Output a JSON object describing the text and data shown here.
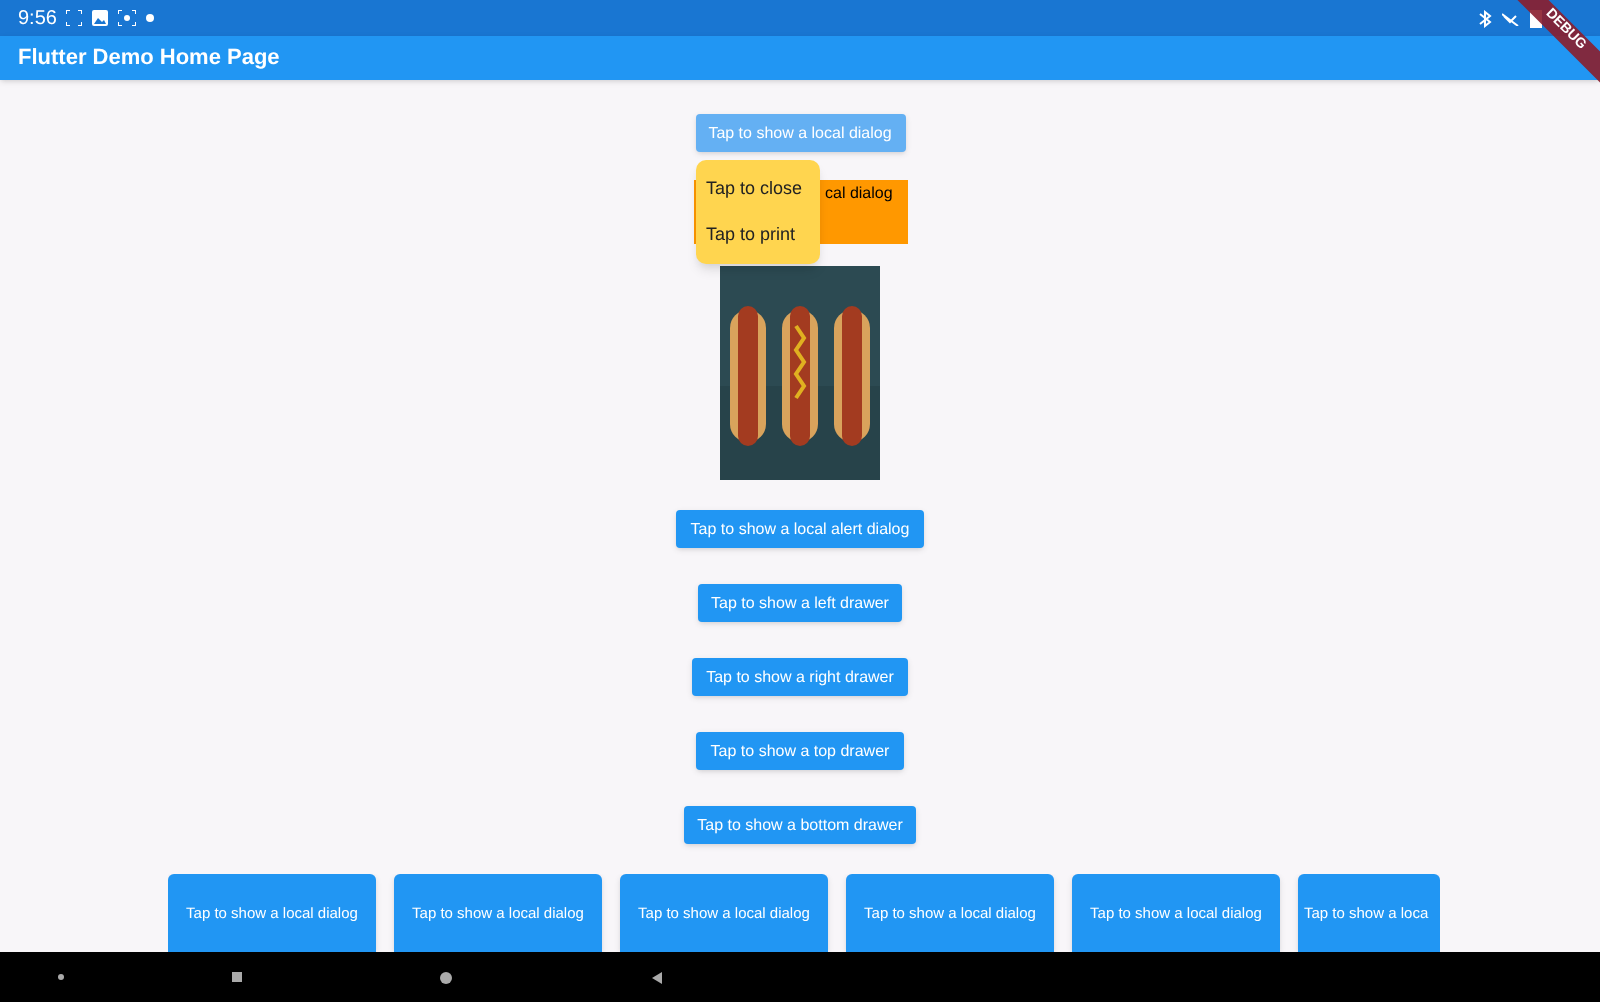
{
  "status_bar": {
    "time": "9:56"
  },
  "debug_banner": "DEBUG",
  "app_bar": {
    "title": "Flutter Demo Home Page"
  },
  "top_button": {
    "label": "Tap to show a local dialog",
    "disabled": true
  },
  "local_dialog": {
    "text": "cal dialog"
  },
  "popup_menu": {
    "items": [
      {
        "label": "Tap to close"
      },
      {
        "label": "Tap to print"
      }
    ]
  },
  "buttons": [
    {
      "label": "Tap to show a local alert dialog"
    },
    {
      "label": "Tap to show a left drawer"
    },
    {
      "label": "Tap to show a right drawer"
    },
    {
      "label": "Tap to show a top drawer"
    },
    {
      "label": "Tap to show a bottom drawer"
    }
  ],
  "bottom_row": [
    {
      "label": "Tap to show a local dialog"
    },
    {
      "label": "Tap to show a local dialog"
    },
    {
      "label": "Tap to show a local dialog"
    },
    {
      "label": "Tap to show a local dialog"
    },
    {
      "label": "Tap to show a local dialog"
    },
    {
      "label": "Tap to show a loca"
    }
  ]
}
